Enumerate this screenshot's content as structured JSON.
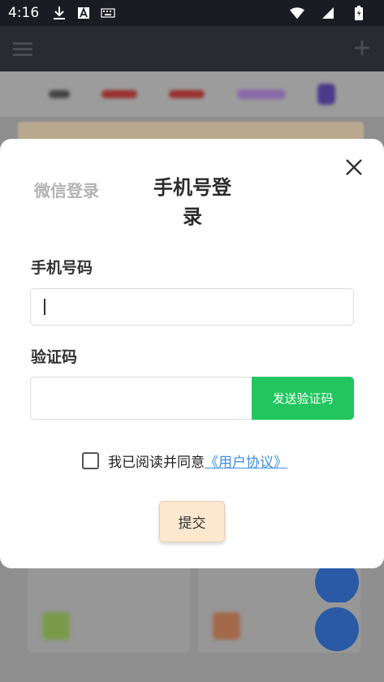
{
  "status_bar": {
    "time": "4:16",
    "icons": [
      "download-icon",
      "a-notification-icon",
      "keyboard-icon",
      "wifi-icon",
      "signal-icon",
      "battery-icon"
    ]
  },
  "background_app": {
    "icons": [
      "menu-icon",
      "plus-icon"
    ]
  },
  "modal": {
    "tab_wechat": "微信登录",
    "tab_phone": "手机号登录",
    "close_icon": "close-icon",
    "phone_label": "手机号码",
    "phone_value": "",
    "code_label": "验证码",
    "code_value": "",
    "send_code_label": "发送验证码",
    "agree_text": "我已阅读并同意",
    "agree_link": "《用户协议》",
    "submit_label": "提交"
  },
  "colors": {
    "accent_green": "#22c55e",
    "link_blue": "#3b8fe0",
    "submit_bg": "#fde8cf"
  }
}
